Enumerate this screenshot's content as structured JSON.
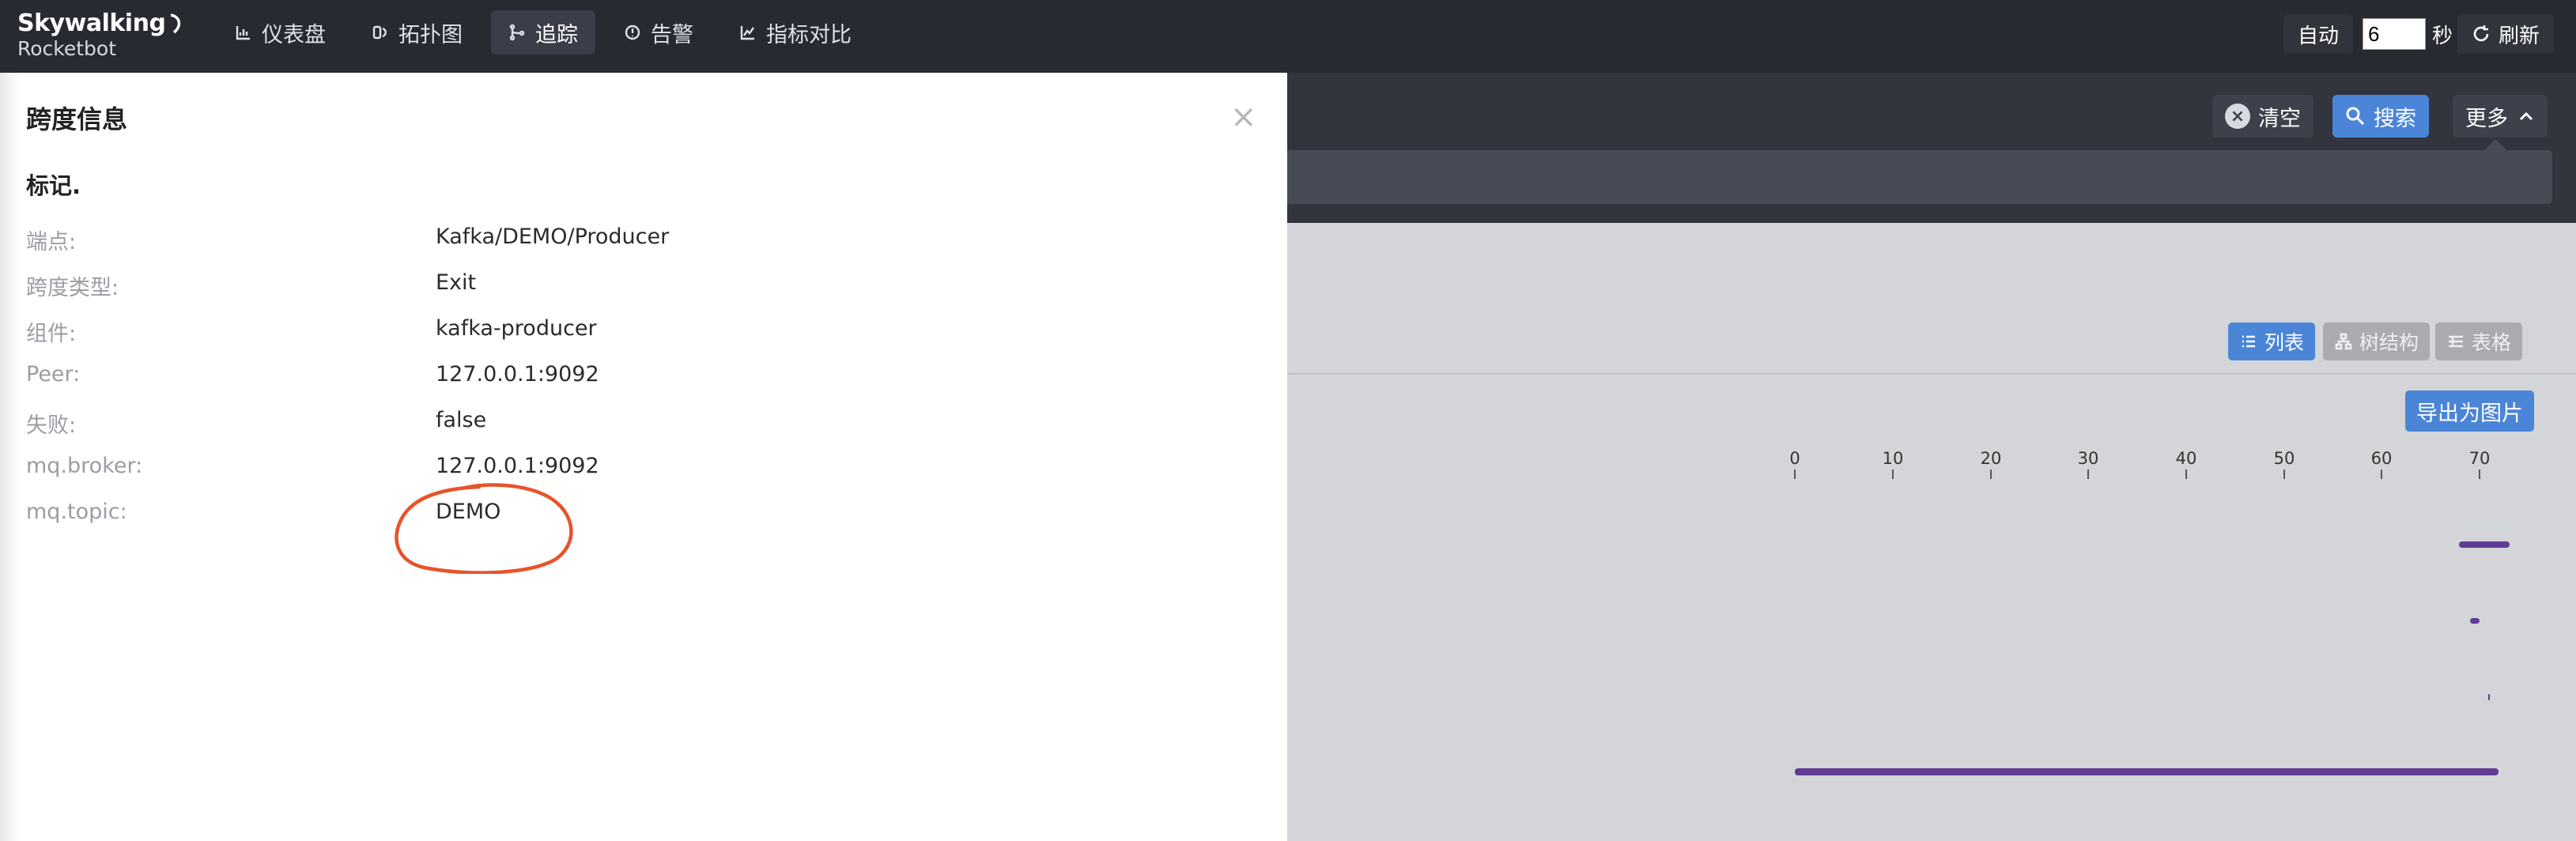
{
  "header": {
    "logo": {
      "main": "Skywalking",
      "sub": "Rocketbot"
    },
    "nav": [
      {
        "label": "仪表盘",
        "icon": "chart-icon",
        "active": false
      },
      {
        "label": "拓扑图",
        "icon": "topology-icon",
        "active": false
      },
      {
        "label": "追踪",
        "icon": "trace-icon",
        "active": true
      },
      {
        "label": "告警",
        "icon": "alarm-icon",
        "active": false
      },
      {
        "label": "指标对比",
        "icon": "compare-icon",
        "active": false
      }
    ],
    "auto_label": "自动",
    "interval_value": "6",
    "interval_unit": "秒",
    "refresh_label": "刷新"
  },
  "toolbar": {
    "clear_label": "清空",
    "search_label": "搜索",
    "more_label": "更多"
  },
  "trace": {
    "views": {
      "list": "列表",
      "tree": "树结构",
      "table": "表格"
    },
    "export_label": "导出为图片",
    "axis_ticks": [
      "0",
      "10",
      "20",
      "30",
      "40",
      "50",
      "60",
      "70"
    ]
  },
  "drawer": {
    "title": "跨度信息",
    "section": "标记.",
    "rows": [
      {
        "key": "端点:",
        "value": "Kafka/DEMO/Producer"
      },
      {
        "key": "跨度类型:",
        "value": "Exit"
      },
      {
        "key": "组件:",
        "value": "kafka-producer"
      },
      {
        "key": "Peer:",
        "value": "127.0.0.1:9092"
      },
      {
        "key": "失败:",
        "value": "false"
      },
      {
        "key": "mq.broker:",
        "value": "127.0.0.1:9092"
      },
      {
        "key": "mq.topic:",
        "value": "DEMO"
      }
    ]
  },
  "colors": {
    "topbar": "#282a31",
    "accent": "#4b85d8",
    "span_bar": "#5f3b93",
    "annotation": "#e8532b"
  }
}
